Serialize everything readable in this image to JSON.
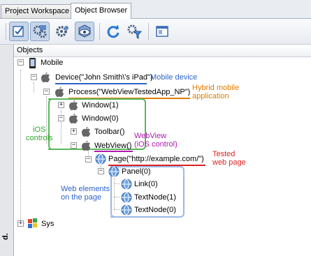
{
  "tabs": [
    {
      "label": "Project Workspace"
    },
    {
      "label": "Object Browser"
    }
  ],
  "toolbar": {
    "buttons": [
      "checkbox-view-icon",
      "gear-group-icon",
      "gear-icon",
      "view-cube-icon",
      "refresh-icon",
      "filter-gear-icon",
      "window-icon"
    ]
  },
  "panel": {
    "header": "Objects",
    "side_label": "d."
  },
  "tree": {
    "mobile": "Mobile",
    "device": "Device(\"John Smith\\'s iPad\")",
    "process": "Process(\"WebViewTestedApp_NP\")",
    "window1": "Window(1)",
    "window0": "Window(0)",
    "toolbar": "Toolbar()",
    "webview": "WebView()",
    "page": "Page(\"http://example.com/\")",
    "panel0": "Panel(0)",
    "link0": "Link(0)",
    "textnode1": "TextNode(1)",
    "textnode0": "TextNode(0)",
    "sys": "Sys"
  },
  "annotations": {
    "mobile_device": "Mobile device",
    "hybrid": [
      "Hybrid mobile",
      "application"
    ],
    "ios_controls": [
      "iOS",
      "controls"
    ],
    "webview": [
      "WebView",
      "(iOS control)"
    ],
    "tested_page": [
      "Tested",
      "web page"
    ],
    "web_elements": [
      "Web elements",
      "on the page"
    ]
  },
  "colors": {
    "blue": "#2e64c8",
    "orange": "#e07b00",
    "green": "#2ea82e",
    "magenta": "#b01ab0",
    "red": "#e02020",
    "lightblue": "#9cb8e6"
  }
}
